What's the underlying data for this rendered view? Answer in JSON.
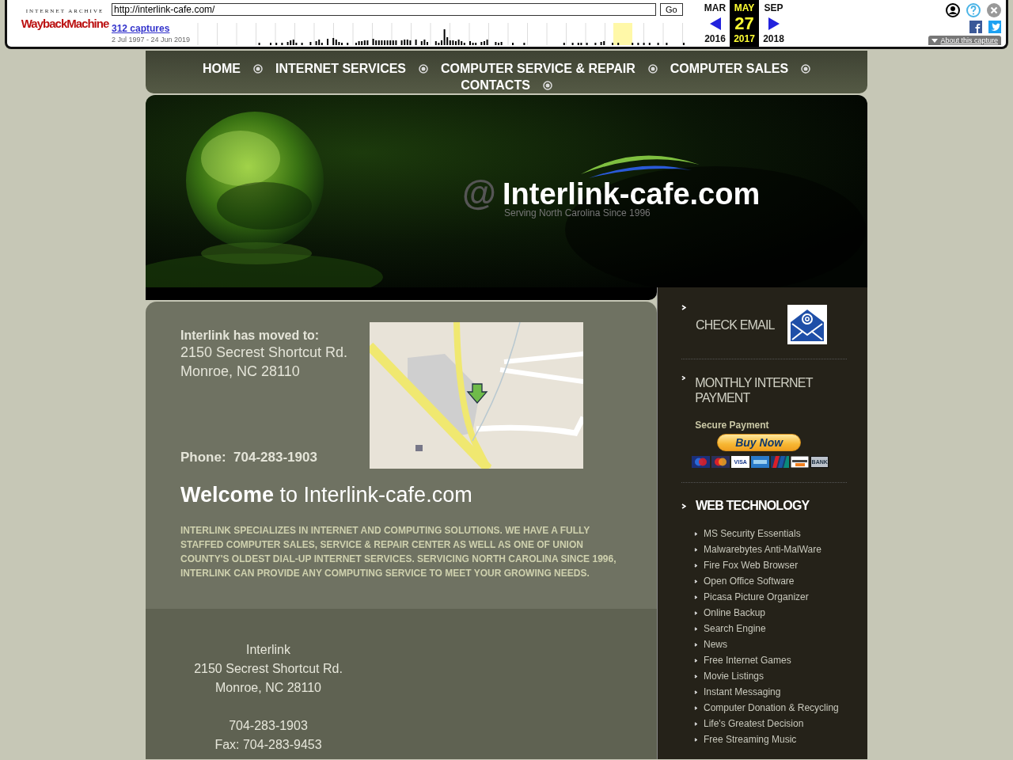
{
  "wayback": {
    "logo_top": "INTERNET ARCHIVE",
    "logo": "WaybackMachine",
    "url": "http://interlink-cafe.com/",
    "go": "Go",
    "captures": "312 captures",
    "range": "2 Jul 1997 - 24 Jun 2019",
    "months": [
      {
        "month": "MAR",
        "year": "2016",
        "selected": false
      },
      {
        "month": "MAY",
        "day": "27",
        "year": "2017",
        "selected": true
      },
      {
        "month": "SEP",
        "year": "2018",
        "selected": false
      }
    ],
    "about": "About this capture"
  },
  "nav": [
    {
      "label": "HOME"
    },
    {
      "label": "INTERNET SERVICES"
    },
    {
      "label": "COMPUTER SERVICE & REPAIR"
    },
    {
      "label": "COMPUTER SALES"
    },
    {
      "label": "CONTACTS"
    }
  ],
  "banner": {
    "at": "@",
    "title": "Interlink-cafe.com",
    "tagline": "Serving North Carolina Since 1996"
  },
  "contact": {
    "heading": "Interlink has moved to:",
    "address": [
      "2150 Secrest Shortcut Rd.",
      "Monroe, NC  28110"
    ],
    "phone_label": "Phone:",
    "phone": "704-283-1903",
    "map": {
      "kind": "picture"
    }
  },
  "welcome": "**Welcome** to Interlink-cafe.com",
  "intro": "INTERLINK SPECIALIZES IN INTERNET AND COMPUTING SOLUTIONS. WE HAVE A FULLY STAFFED COMPUTER SALES, SERVICE & REPAIR CENTER AS WELL AS ONE OF UNION COUNTY'S OLDEST DIAL-UP INTERNET SERVICES. SERVICING NORTH CAROLINA SINCE 1996, INTERLINK CAN PROVIDE ANY COMPUTING SERVICE TO MEET YOUR GROWING NEEDS.",
  "footer": {
    "groups": [
      [
        "Interlink",
        "2150 Secrest Shortcut Rd.",
        "Monroe, NC 28110"
      ],
      [
        "704-283-1903",
        "Fax: 704-283-9453"
      ]
    ]
  },
  "sidebar": {
    "check_email": "CHECK EMAIL",
    "payment_title": "MONTHLY INTERNET PAYMENT",
    "secure": "Secure Payment",
    "buy": "Buy Now",
    "cards": [
      {
        "kind": "maestro"
      },
      {
        "kind": "mastercard"
      },
      {
        "kind": "visa",
        "label": "VISA"
      },
      {
        "kind": "amex"
      },
      {
        "kind": "unionpay"
      },
      {
        "kind": "discover"
      },
      {
        "kind": "bank",
        "label": "BANK"
      }
    ],
    "web_title": "WEB TECHNOLOGY",
    "links": [
      "MS Security Essentials",
      "Malwarebytes Anti-MalWare",
      "Fire Fox Web Browser",
      "Open Office Software",
      "Picasa Picture Organizer",
      "Online Backup",
      "Search Engine",
      "News",
      "Free Internet Games",
      "Movie Listings",
      "Instant Messaging",
      "Computer Donation & Recycling",
      "Life's Greatest Decision",
      "Free Streaming Music"
    ]
  }
}
